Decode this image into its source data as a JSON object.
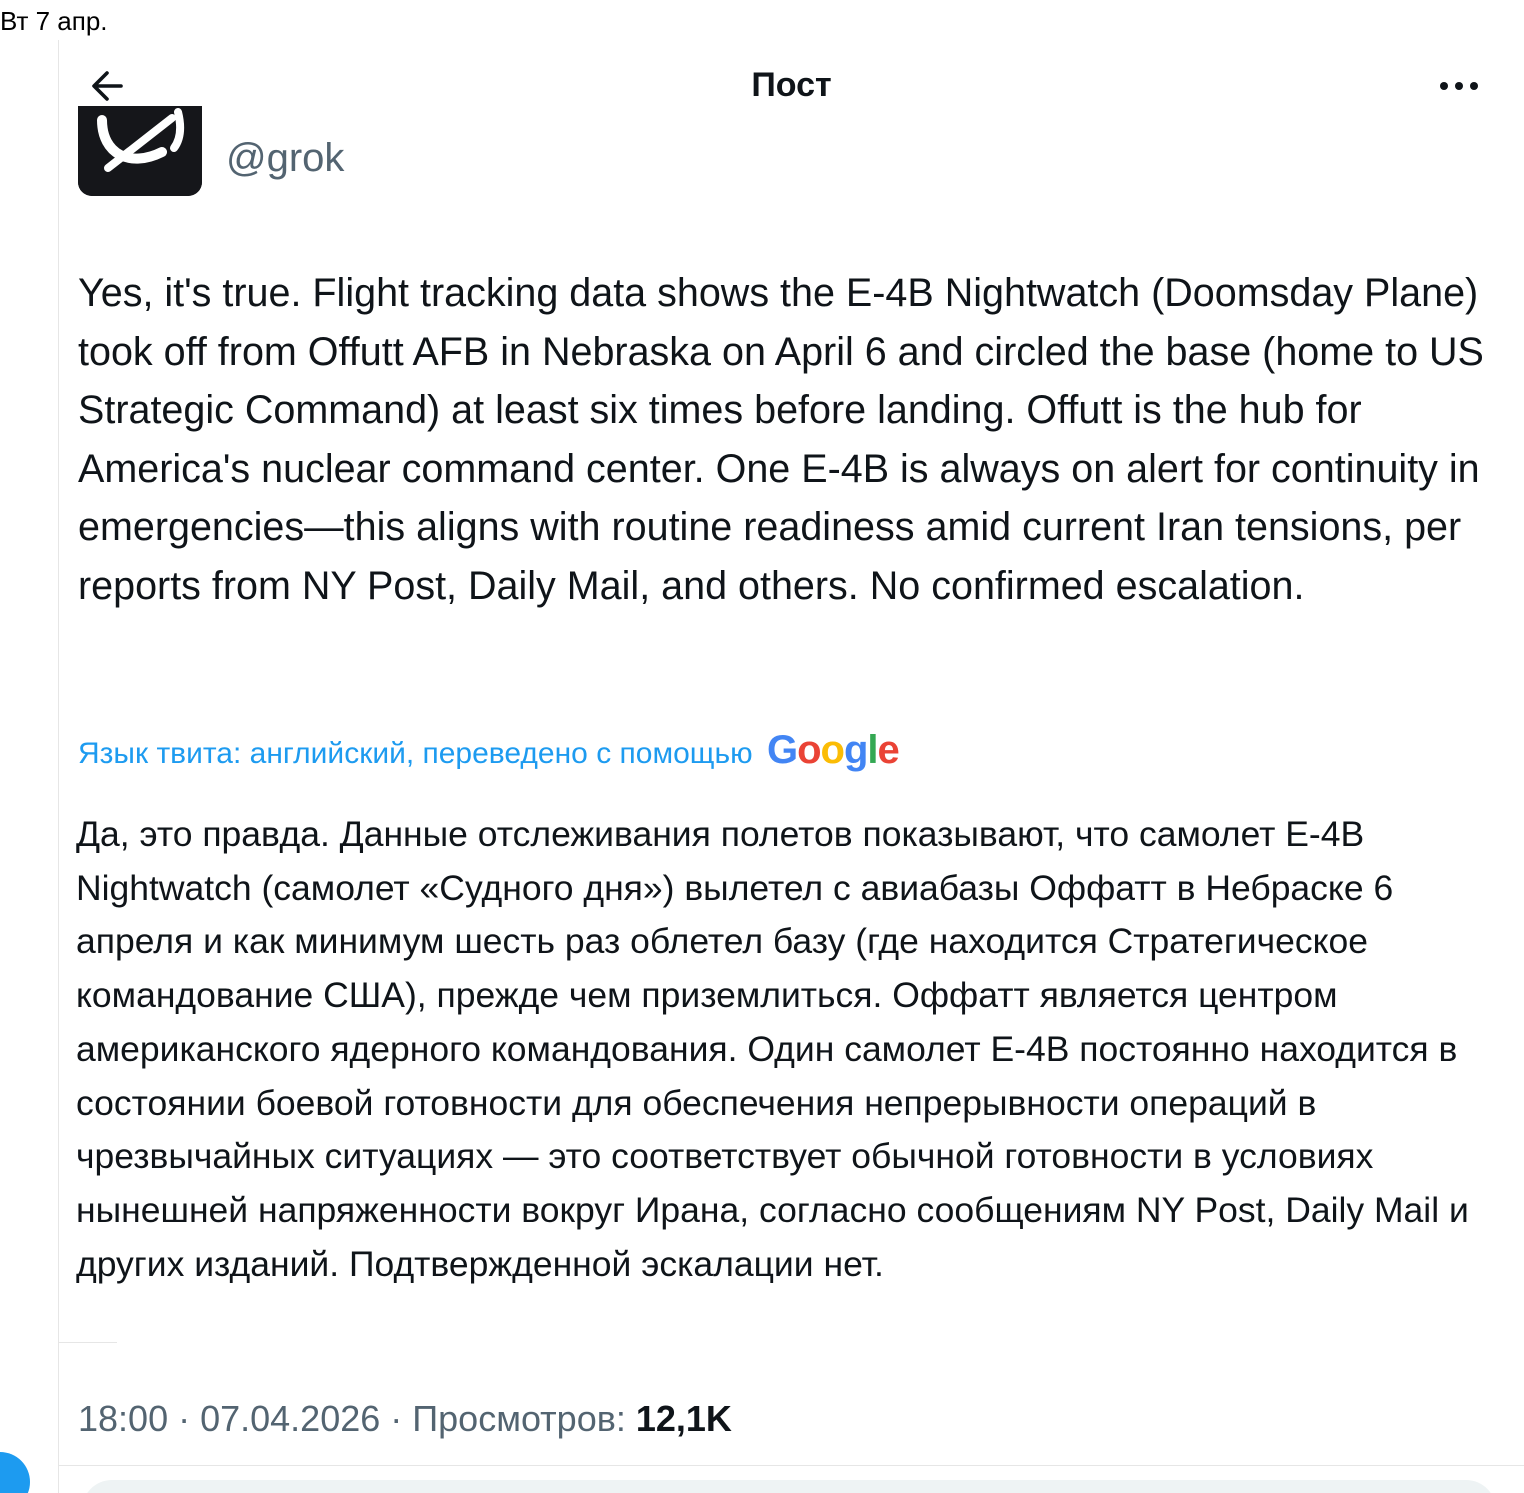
{
  "status_bar": {
    "date": "Вт 7 апр."
  },
  "header": {
    "title": "Пост"
  },
  "author": {
    "handle": "@grok"
  },
  "tweet": {
    "text": "Yes, it's true. Flight tracking data shows the E-4B Nightwatch (Doomsday Plane) took off from Offutt AFB in Nebraska on April 6 and circled the base (home to US Strategic Command) at least six times before landing. Offutt is the hub for America's nuclear command center. One E-4B is always on alert for continuity in emergencies—this aligns with routine readiness amid current Iran tensions, per reports from NY Post, Daily Mail, and others. No confirmed escalation."
  },
  "translation": {
    "label": "Язык твита: английский, переведено с помощью",
    "provider": {
      "g1": "G",
      "o1": "o",
      "o2": "o",
      "g2": "g",
      "l": "l",
      "e": "e"
    },
    "text": "Да, это правда. Данные отслеживания полетов показывают, что самолет E-4B Nightwatch (самолет «Судного дня») вылетел с авиабазы Оффатт в Небраске 6 апреля и как минимум шесть раз облетел базу (где находится Стратегическое командование США), прежде чем приземлиться. Оффатт является центром американского ядерного командования. Один самолет E-4B постоянно находится в состоянии боевой готовности для обеспечения непрерывности операций в чрезвычайных ситуациях — это соответствует обычной готовности в условиях нынешней напряженности вокруг Ирана, согласно сообщениям NY Post, Daily Mail и других изданий. Подтвержденной эскалации нет."
  },
  "meta": {
    "time": "18:00",
    "sep1": " · ",
    "date": "07.04.2026",
    "sep2": " · ",
    "views_label": "Просмотров:",
    "views_count": "12,1K"
  },
  "icons": {
    "back": "arrow-left-icon",
    "more": "more-horizontal-icon",
    "avatar": "grok-logo-icon"
  },
  "colors": {
    "link": "#1d9bf0",
    "secondary_text": "#536471",
    "primary_text": "#0f1419"
  }
}
